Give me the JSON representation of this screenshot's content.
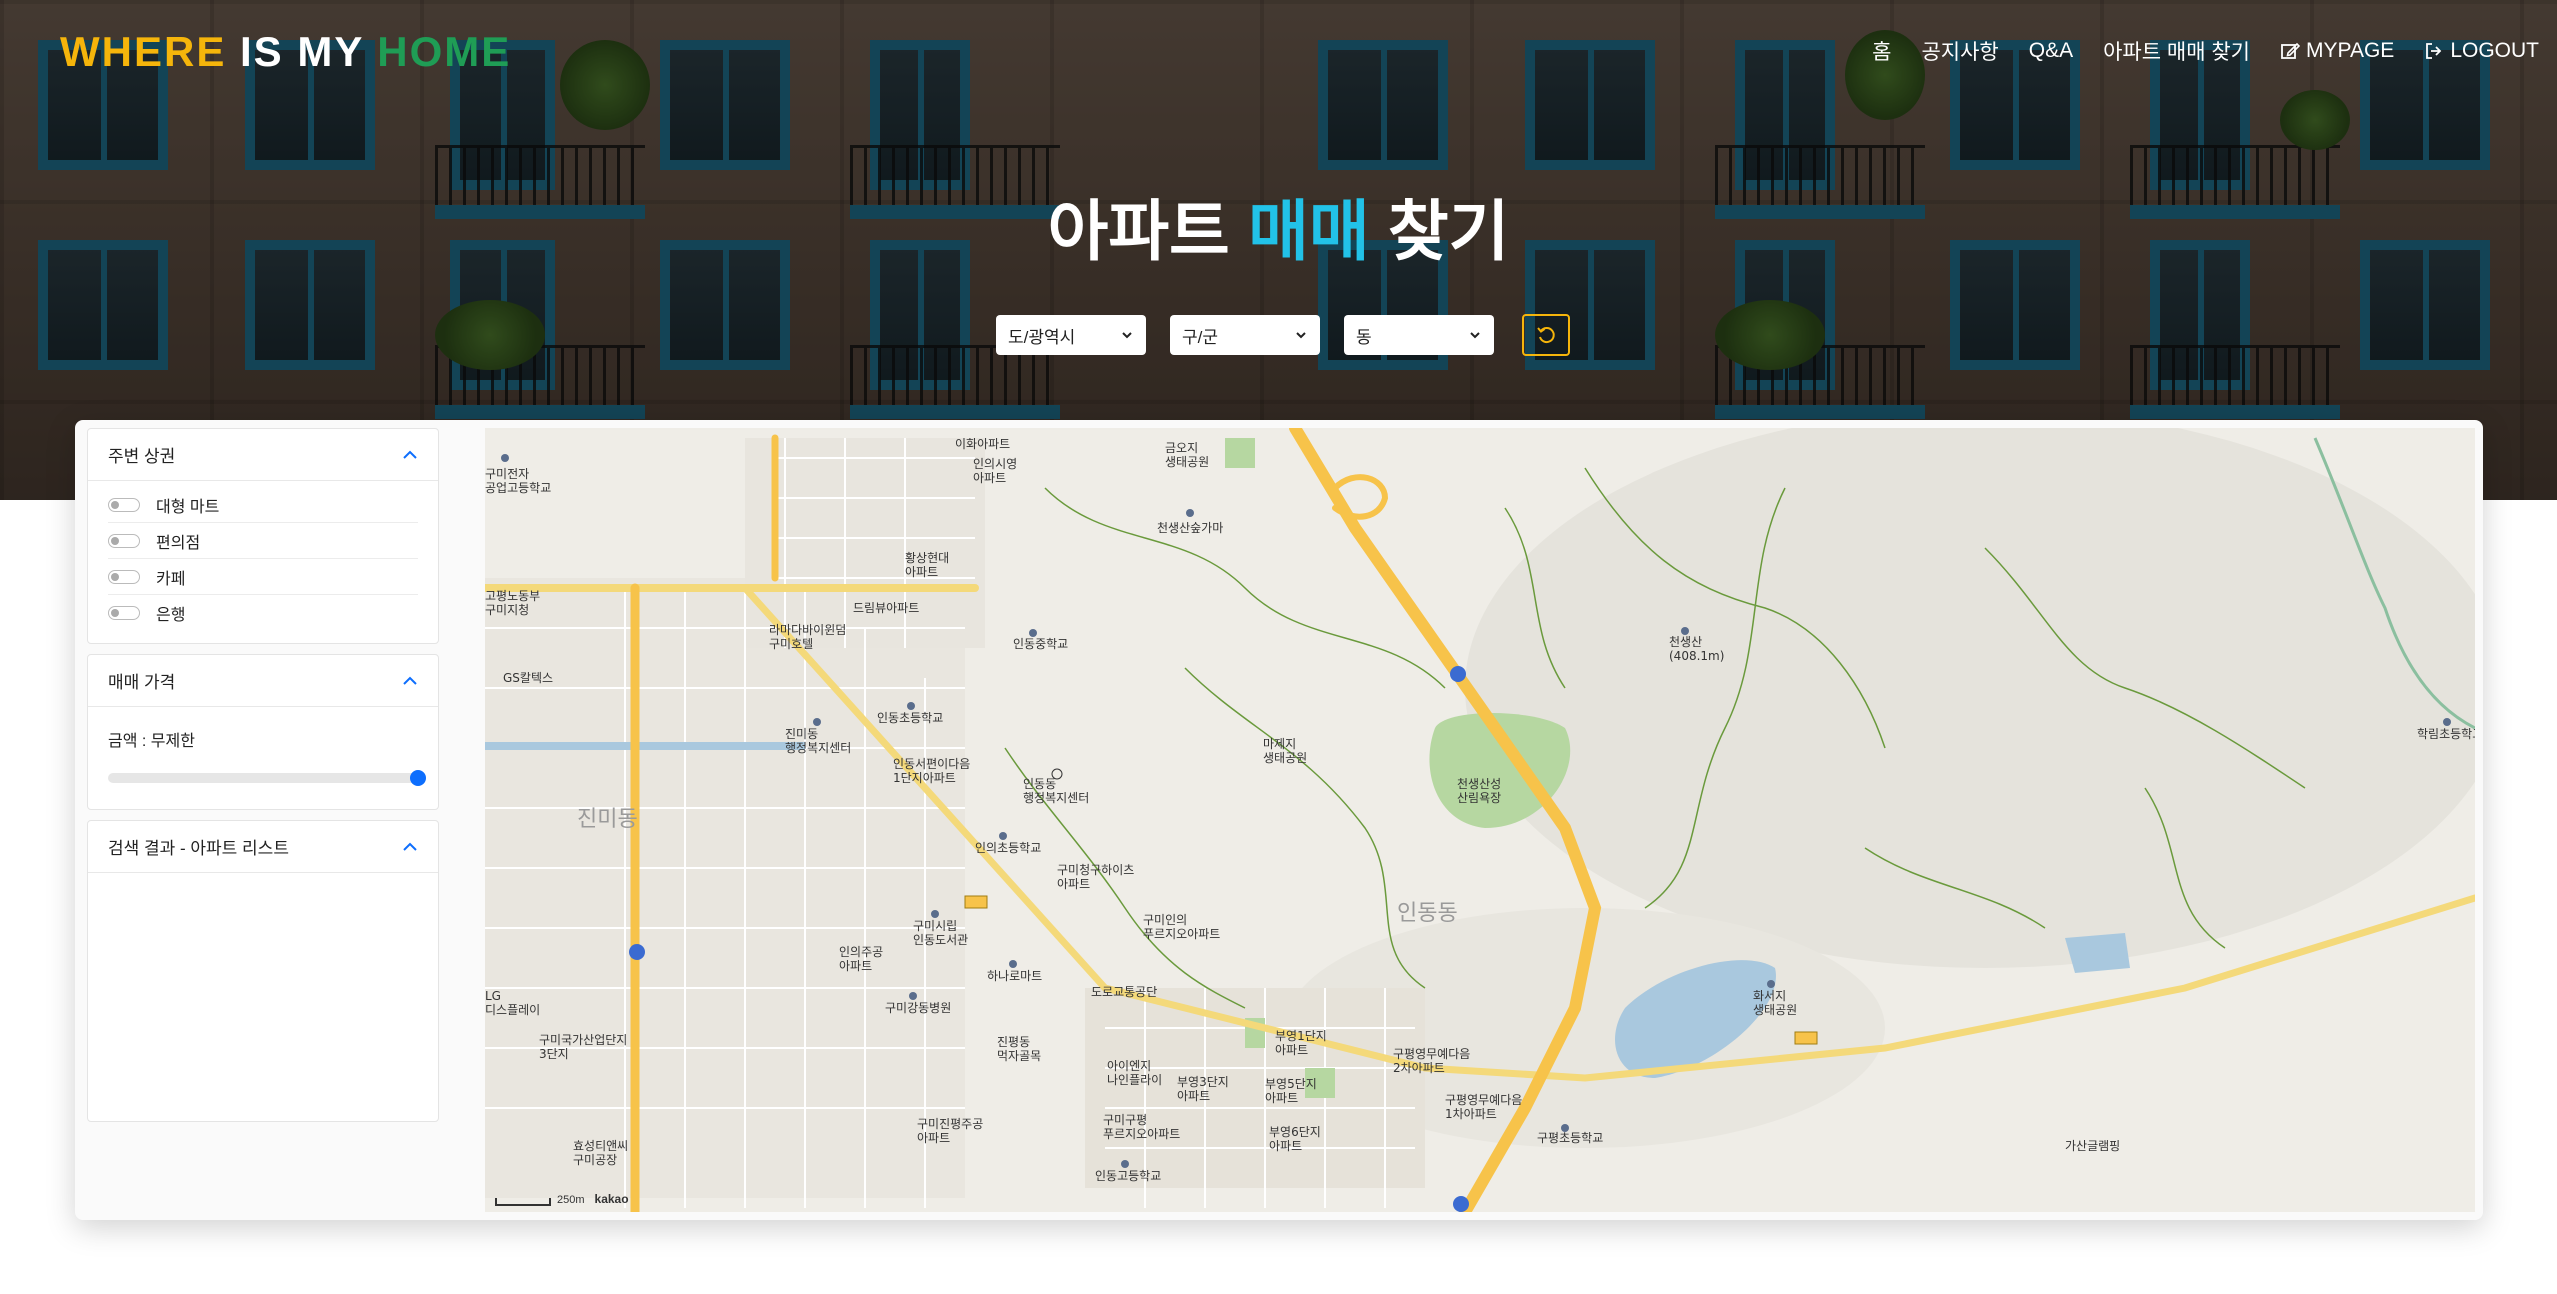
{
  "brand": {
    "word1": "WHERE",
    "word2": "IS MY",
    "word3": "HOME"
  },
  "nav": {
    "home": "홈",
    "notice": "공지사항",
    "qna": "Q&A",
    "apt_search": "아파트 매매 찾기",
    "mypage": "MYPAGE",
    "logout": "LOGOUT"
  },
  "hero": {
    "title_a": "아파트",
    "title_b": "매매",
    "title_c": "찾기"
  },
  "filters": {
    "sido": "도/광역시",
    "gugun": "구/군",
    "dong": "동"
  },
  "sidebar": {
    "nearby": {
      "title": "주변 상권",
      "items": [
        "대형 마트",
        "편의점",
        "카페",
        "은행"
      ]
    },
    "price": {
      "title": "매매 가격",
      "label": "금액 : 무제한",
      "value_fraction": 1.0
    },
    "results": {
      "title": "검색 결과 - 아파트 리스트"
    }
  },
  "map": {
    "labels": {
      "apt_ihwa": "이화아파트",
      "apt_inui": "인의시영\n아파트",
      "park_geumo": "금오지\n생태공원",
      "cheonsaeng_kiln": "천생산숲가마",
      "school_gumi_elec": "구미전자\n공업고등학교",
      "apt_hwangsang": "황상현대\n아파트",
      "apt_dream": "드림뷰아파트",
      "hotel_ramada": "라마다바이윈덤\n구미호텔",
      "school_indong_mid": "인동중학교",
      "gs": "GS칼텍스",
      "school_indong_elem": "인동초등학교",
      "jinmi_center": "진미동\n행정복지센터",
      "park_madu": "마제지\n생태공원",
      "apt_indong_seomyeon": "인동서편이다음\n1단지아파트",
      "indong_center": "인동동\n행정복지센터",
      "mt_cheonsaeng": "천생산\n(408.1m)",
      "jinmi_dong": "진미동",
      "school_inui_elem": "인의초등학교",
      "apt_gumi_cheonggu": "구미청구하이츠\n아파트",
      "park_cheonsaeng_forest": "천생산성\n산림욕장",
      "library_gumi": "구미시립\n인동도서관",
      "apt_inui_jugong": "인의주공\n아파트",
      "apt_gumi_inui": "구미인의\n푸르지오아파트",
      "indong_dong": "인동동",
      "homeplus": "하나로마트",
      "park_hwaseo": "화서지\n생태공원",
      "lg": "LG\n디스플레이",
      "hospital_gangdong": "구미강동병원",
      "road_park": "도로교통공단",
      "jinpyeong_market": "진평동\n먹자골목",
      "gumi_industrial": "구미국가산업단지\n3단지",
      "apt_ienc": "아이엔지\n나인플라이",
      "apt_buyeong1": "부영1단지\n아파트",
      "apt_gupyeong_doosan": "구평영무예다음\n2차아파트",
      "apt_buyeong3": "부영3단지\n아파트",
      "apt_buyeong5": "부영5단지\n아파트",
      "apt_gupyeong_mue": "구평영무예다음\n1차아파트",
      "apt_gumi_jinpyeong_jugong": "구미진평주공\n아파트",
      "apt_gumi_gupyeong": "구미구평\n푸르지오아파트",
      "apt_buyeong6": "부영6단지\n아파트",
      "school_gupyeong": "구평초등학교",
      "camping": "가산글램핑",
      "hyosung": "효성티앤씨\n구미공장",
      "school_indong_high": "인동고등학교",
      "school_hakdong": "학림초등학교",
      "gokpyeong": "고평노동부\n구미지청"
    },
    "scale_label": "250m",
    "provider": "kakao"
  },
  "colors": {
    "brand_yellow": "#f5b50b",
    "brand_green": "#1f9d55",
    "title_highlight": "#22c2e8",
    "slider_thumb": "#0d6efd",
    "highway": "#f7c34a"
  }
}
